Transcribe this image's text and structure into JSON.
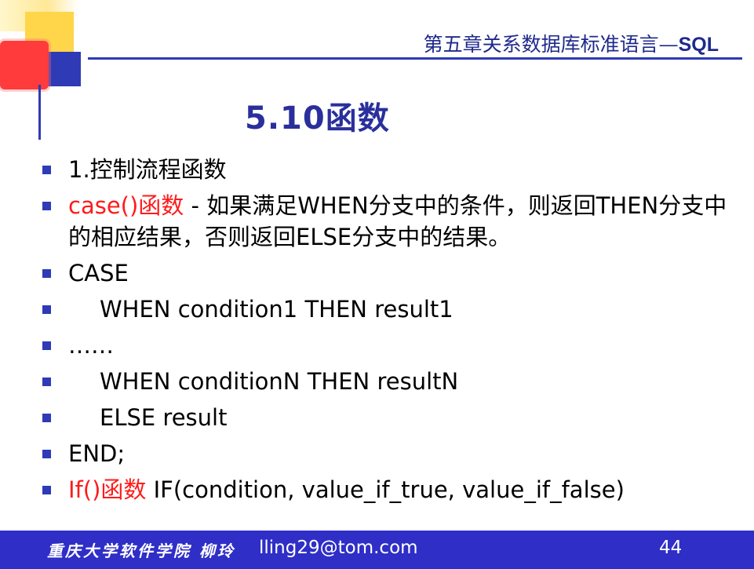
{
  "header": {
    "chapter_prefix": "第五章关系数据库标准语言—",
    "chapter_suffix": "SQL"
  },
  "slide": {
    "title": "5.10函数",
    "bullets": [
      {
        "text": "1.控制流程函数"
      },
      {
        "highlight": "case()函数",
        "text": " - 如果满足WHEN分支中的条件，则返回THEN分支中的相应结果，否则返回ELSE分支中的结果。"
      },
      {
        "text": "CASE"
      },
      {
        "text": "WHEN condition1 THEN result1"
      },
      {
        "text": "……"
      },
      {
        "text": "WHEN conditionN THEN resultN"
      },
      {
        "text": "ELSE result"
      },
      {
        "text": "END;"
      },
      {
        "highlight": "If()函数",
        "text": " IF(condition, value_if_true, value_if_false)"
      }
    ]
  },
  "footer": {
    "school": "重庆大学软件学院 柳玲",
    "email": "lling29@tom.com",
    "page_number": "44"
  },
  "colors": {
    "accent_blue": "#2f3ab6",
    "highlight_red": "#ff1a1a",
    "footer_bg": "#2f2ec7"
  }
}
